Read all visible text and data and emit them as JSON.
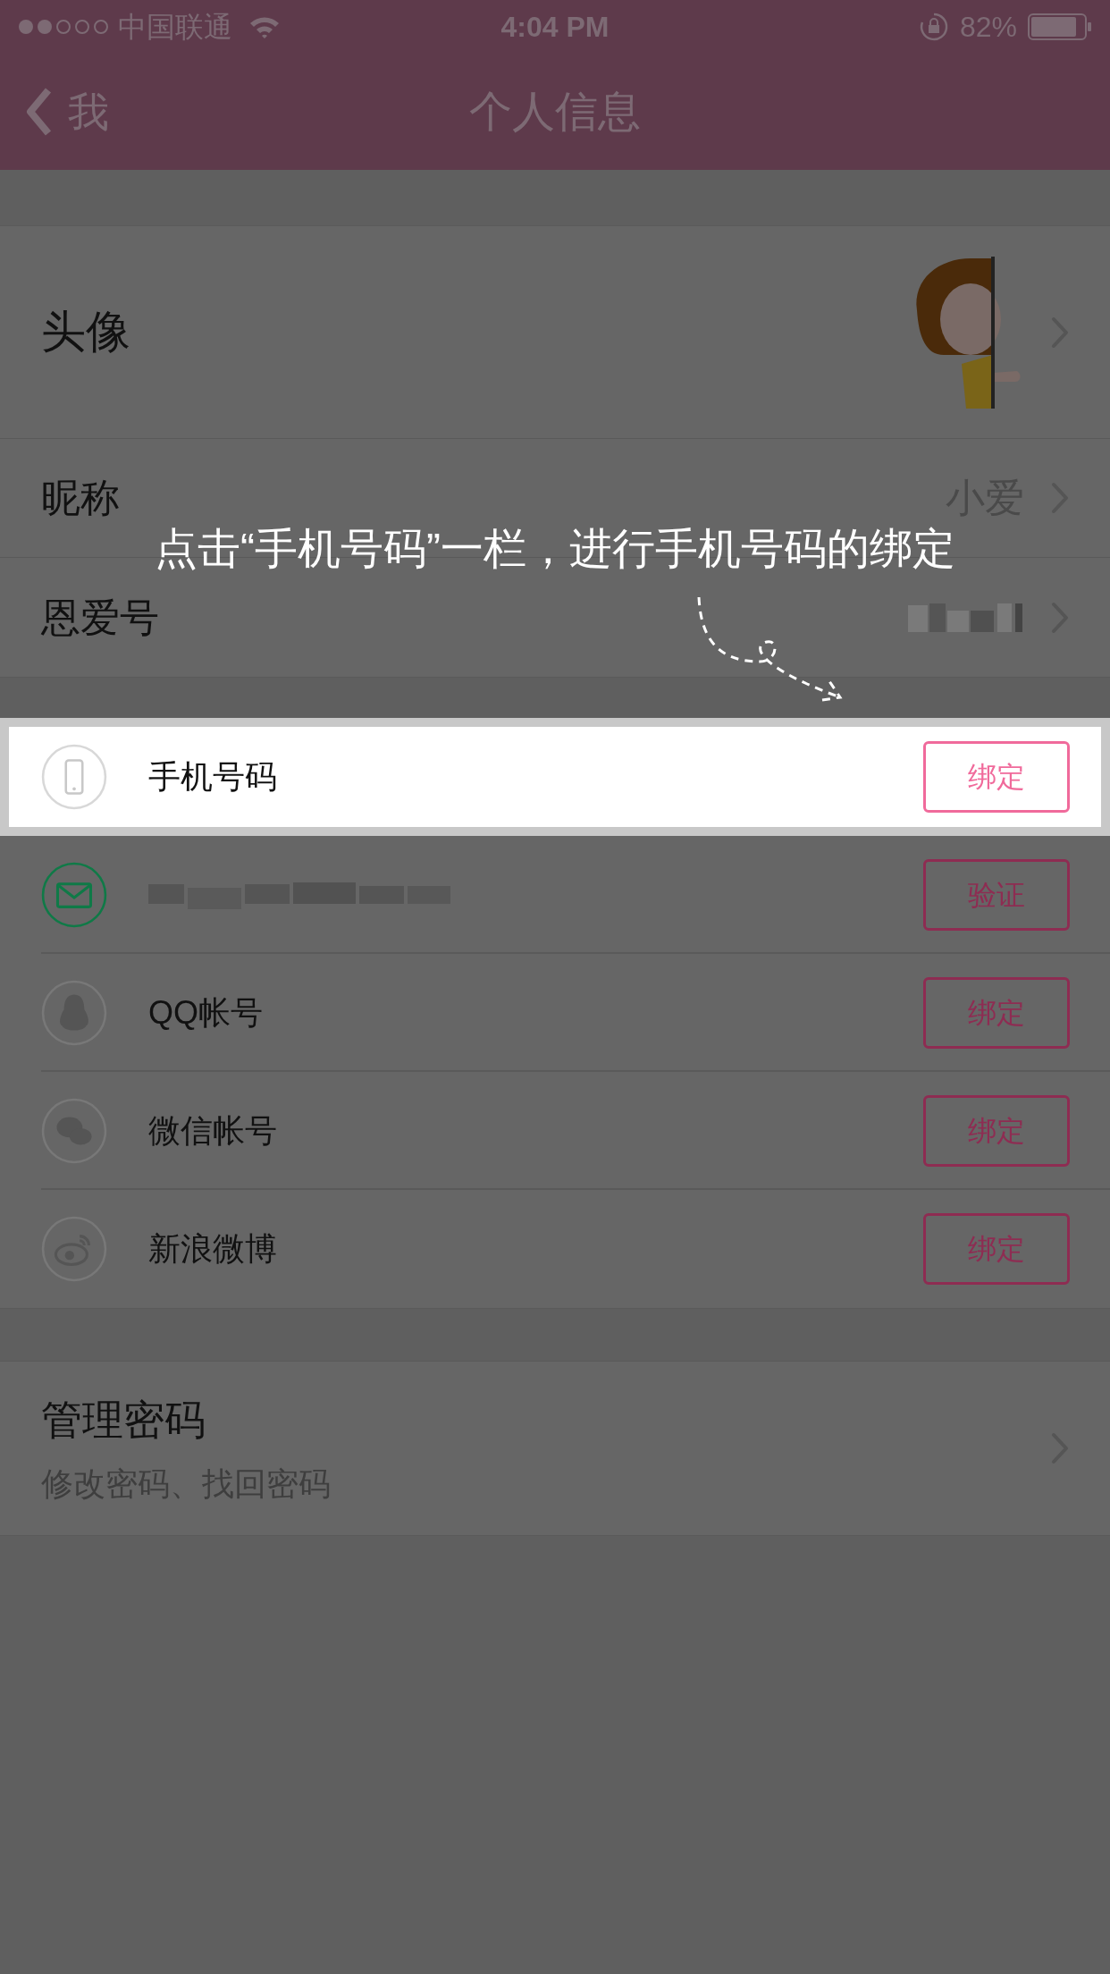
{
  "status_bar": {
    "carrier": "中国联通",
    "time": "4:04 PM",
    "battery": "82%"
  },
  "nav": {
    "back": "我",
    "title": "个人信息"
  },
  "profile": [
    {
      "kind": "avatar",
      "label": "头像"
    },
    {
      "kind": "value",
      "label": "昵称",
      "value": "小爱"
    },
    {
      "kind": "blurred",
      "label": "恩爱号"
    }
  ],
  "hint": "点击“手机号码”一栏，进行手机号码的绑定",
  "accounts": [
    {
      "kind": "phone",
      "label": "手机号码",
      "action": "绑定",
      "highlighted": true
    },
    {
      "kind": "mail",
      "action": "验证",
      "highlighted": false
    },
    {
      "kind": "penguin",
      "label": "QQ帐号",
      "action": "绑定",
      "highlighted": false
    },
    {
      "kind": "chat",
      "label": "微信帐号",
      "action": "绑定",
      "highlighted": false
    },
    {
      "kind": "eye",
      "label": "新浪微博",
      "action": "绑定",
      "highlighted": false
    }
  ],
  "password": {
    "title": "管理密码",
    "subtitle": "修改密码、找回密码"
  }
}
